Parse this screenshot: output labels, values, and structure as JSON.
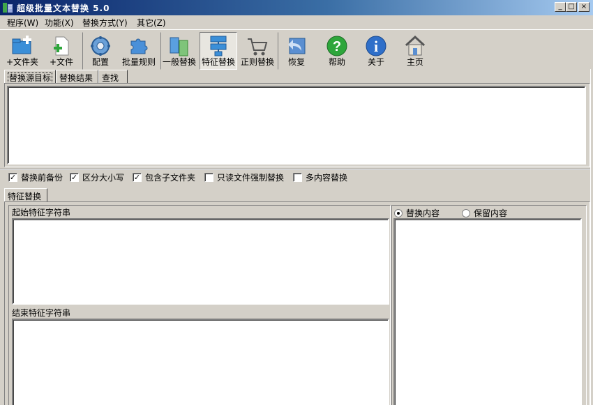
{
  "window": {
    "title": "超级批量文本替换 5.0",
    "controls": {
      "minimize": "_",
      "maximize": "□",
      "close": "×"
    }
  },
  "menubar": {
    "items": [
      {
        "label": "程序(W)"
      },
      {
        "label": "功能(X)"
      },
      {
        "label": "替换方式(Y)"
      },
      {
        "label": "其它(Z)"
      }
    ]
  },
  "toolbar": {
    "buttons": [
      {
        "label": "+文件夹",
        "icon": "add-folder-icon"
      },
      {
        "label": "+文件",
        "icon": "add-file-icon"
      },
      {
        "label": "配置",
        "icon": "gear-icon"
      },
      {
        "label": "批量规则",
        "icon": "puzzle-icon"
      },
      {
        "label": "一般替换",
        "icon": "swap-icon"
      },
      {
        "label": "特征替换",
        "icon": "network-icon"
      },
      {
        "label": "正则替换",
        "icon": "cart-icon"
      },
      {
        "label": "恢复",
        "icon": "undo-arrow-icon"
      },
      {
        "label": "帮助",
        "icon": "help-icon"
      },
      {
        "label": "关于",
        "icon": "info-icon"
      },
      {
        "label": "主页",
        "icon": "home-icon"
      }
    ],
    "active": "特征替换"
  },
  "source_tabs": {
    "tabs": [
      {
        "label": "替换源目标"
      },
      {
        "label": "替换结果"
      },
      {
        "label": "查找"
      }
    ],
    "selected": "替换源目标"
  },
  "options": {
    "checkboxes": [
      {
        "label": "替换前备份",
        "checked": true
      },
      {
        "label": "区分大小写",
        "checked": true
      },
      {
        "label": "包含子文件夹",
        "checked": true
      },
      {
        "label": "只读文件强制替换",
        "checked": false
      },
      {
        "label": "多内容替换",
        "checked": false
      }
    ]
  },
  "mode_tab": {
    "label": "特征替换"
  },
  "feature": {
    "start_label": "起始特征字符串",
    "end_label": "结束特征字符串",
    "radio_replace": "替换内容",
    "radio_keep": "保留内容",
    "selected_radio": "替换内容",
    "start_value": "",
    "end_value": "",
    "content_value": ""
  }
}
